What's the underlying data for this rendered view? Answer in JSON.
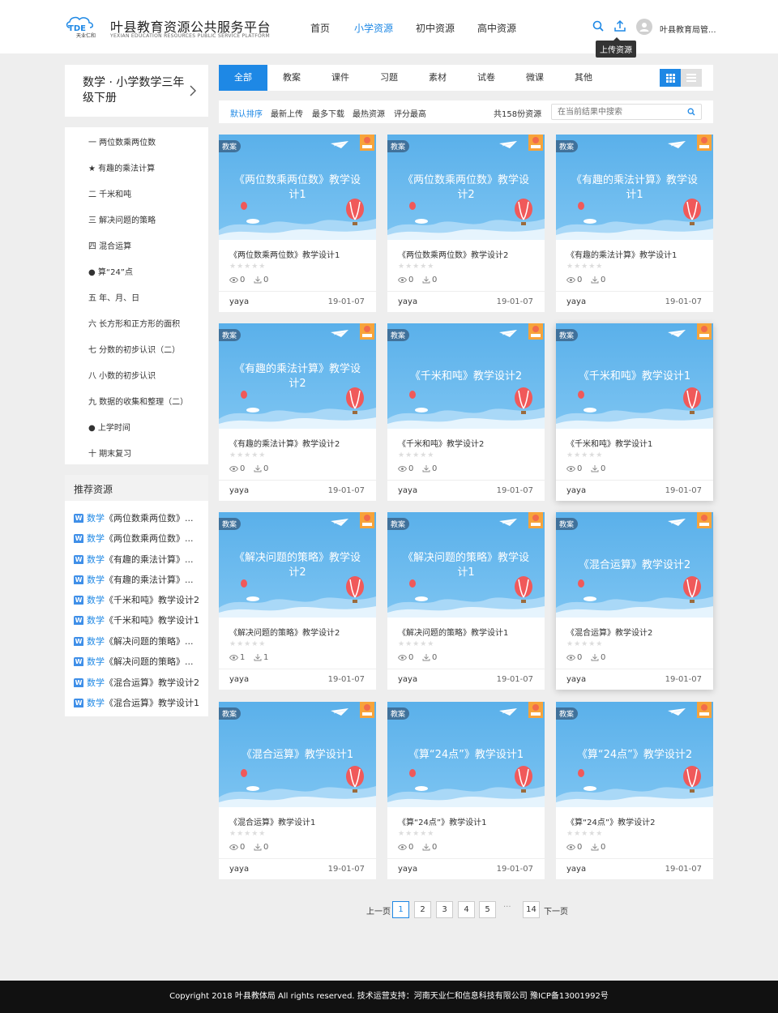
{
  "header": {
    "brand_cn": "叶县教育资源公共服务平台",
    "brand_en": "YEXIAN EDUCATION RESOURCES PUBLIC SERVICE PLATFORM",
    "logo_text": "天业仁和",
    "nav": [
      "首页",
      "小学资源",
      "初中资源",
      "高中资源"
    ],
    "active_nav": "小学资源",
    "search_icon": "search-icon",
    "upload_icon": "upload-icon",
    "upload_tooltip": "上传资源",
    "user_name": "叶县教育局管...",
    "accent": "#1e88e5"
  },
  "sidebar": {
    "subject": "数学 · 小学数学三年级下册",
    "chapters": [
      "一 两位数乘两位数",
      "★ 有趣的乘法计算",
      "二 千米和吨",
      "三 解决问题的策略",
      "四 混合运算",
      "● 算“24”点",
      "五 年、月、日",
      "六 长方形和正方形的面积",
      "七 分数的初步认识（二）",
      "八 小数的初步认识",
      "九 数据的收集和整理（二）",
      "● 上学时间",
      "十 期末复习"
    ],
    "recommend_title": "推荐资源",
    "recommend": [
      {
        "subject": "数学",
        "title": "《两位数乘两位数》..."
      },
      {
        "subject": "数学",
        "title": "《两位数乘两位数》..."
      },
      {
        "subject": "数学",
        "title": "《有趣的乘法计算》..."
      },
      {
        "subject": "数学",
        "title": "《有趣的乘法计算》..."
      },
      {
        "subject": "数学",
        "title": "《千米和吨》教学设计2"
      },
      {
        "subject": "数学",
        "title": "《千米和吨》教学设计1"
      },
      {
        "subject": "数学",
        "title": "《解决问题的策略》..."
      },
      {
        "subject": "数学",
        "title": "《解决问题的策略》..."
      },
      {
        "subject": "数学",
        "title": "《混合运算》教学设计2"
      },
      {
        "subject": "数学",
        "title": "《混合运算》教学设计1"
      }
    ]
  },
  "tabs": [
    "全部",
    "教案",
    "课件",
    "习题",
    "素材",
    "试卷",
    "微课",
    "其他"
  ],
  "sort": {
    "options": [
      "默认排序",
      "最新上传",
      "最多下载",
      "最热资源",
      "评分最高"
    ],
    "count": "共158份资源",
    "search_placeholder": "在当前结果中搜索"
  },
  "cards": [
    {
      "badge": "教案",
      "thumb1": "《两位数乘两位数》教学设",
      "thumb2": "计1",
      "title": "《两位数乘两位数》教学设计1",
      "views": "0",
      "downloads": "0",
      "author": "yaya",
      "date": "19-01-07"
    },
    {
      "badge": "教案",
      "thumb1": "《两位数乘两位数》教学设",
      "thumb2": "计2",
      "title": "《两位数乘两位数》教学设计2",
      "views": "0",
      "downloads": "0",
      "author": "yaya",
      "date": "19-01-07"
    },
    {
      "badge": "教案",
      "thumb1": "《有趣的乘法计算》教学设",
      "thumb2": "计1",
      "title": "《有趣的乘法计算》教学设计1",
      "views": "0",
      "downloads": "0",
      "author": "yaya",
      "date": "19-01-07"
    },
    {
      "badge": "教案",
      "thumb1": "《有趣的乘法计算》教学设",
      "thumb2": "计2",
      "title": "《有趣的乘法计算》教学设计2",
      "views": "0",
      "downloads": "0",
      "author": "yaya",
      "date": "19-01-07"
    },
    {
      "badge": "教案",
      "thumb1": "《千米和吨》教学设计2",
      "thumb2": "",
      "title": "《千米和吨》教学设计2",
      "views": "0",
      "downloads": "0",
      "author": "yaya",
      "date": "19-01-07"
    },
    {
      "badge": "教案",
      "thumb1": "《千米和吨》教学设计1",
      "thumb2": "",
      "title": "《千米和吨》教学设计1",
      "views": "0",
      "downloads": "0",
      "author": "yaya",
      "date": "19-01-07"
    },
    {
      "badge": "教案",
      "thumb1": "《解决问题的策略》教学设",
      "thumb2": "计2",
      "title": "《解决问题的策略》教学设计2",
      "views": "1",
      "downloads": "1",
      "author": "yaya",
      "date": "19-01-07"
    },
    {
      "badge": "教案",
      "thumb1": "《解决问题的策略》教学设",
      "thumb2": "计1",
      "title": "《解决问题的策略》教学设计1",
      "views": "0",
      "downloads": "0",
      "author": "yaya",
      "date": "19-01-07"
    },
    {
      "badge": "教案",
      "thumb1": "《混合运算》教学设计2",
      "thumb2": "",
      "title": "《混合运算》教学设计2",
      "views": "0",
      "downloads": "0",
      "author": "yaya",
      "date": "19-01-07"
    },
    {
      "badge": "教案",
      "thumb1": "《混合运算》教学设计1",
      "thumb2": "",
      "title": "《混合运算》教学设计1",
      "views": "0",
      "downloads": "0",
      "author": "yaya",
      "date": "19-01-07"
    },
    {
      "badge": "教案",
      "thumb1": "《算“24点”》教学设计1",
      "thumb2": "",
      "title": "《算“24点”》教学设计1",
      "views": "0",
      "downloads": "0",
      "author": "yaya",
      "date": "19-01-07"
    },
    {
      "badge": "教案",
      "thumb1": "《算“24点”》教学设计2",
      "thumb2": "",
      "title": "《算“24点”》教学设计2",
      "views": "0",
      "downloads": "0",
      "author": "yaya",
      "date": "19-01-07"
    }
  ],
  "pagination": {
    "prev": "上一页",
    "pages": [
      "1",
      "2",
      "3",
      "4",
      "5"
    ],
    "ellipsis": "···",
    "last": "14",
    "next": "下一页",
    "current": "1"
  },
  "footer": "Copyright 2018 叶县教体局 All rights reserved. 技术运营支持：河南天业仁和信息科技有限公司 豫ICP备13001992号"
}
